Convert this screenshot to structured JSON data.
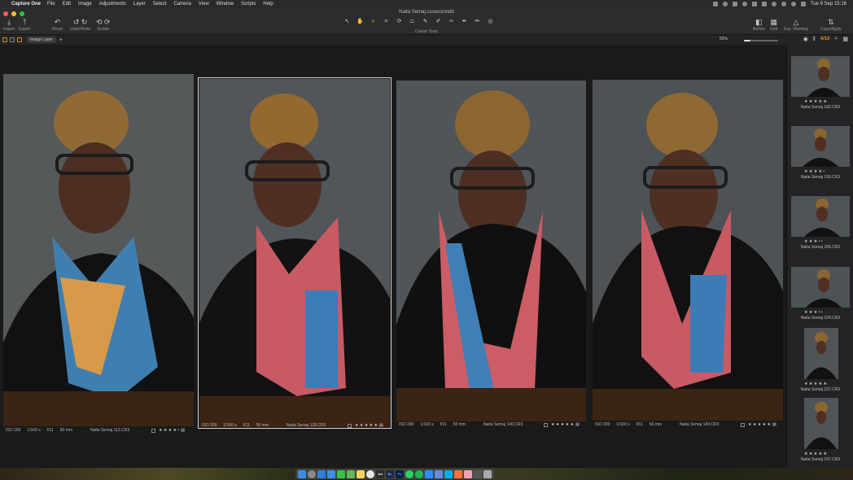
{
  "menubar": {
    "app_name": "Capture One",
    "items": [
      "File",
      "Edit",
      "Image",
      "Adjustments",
      "Layer",
      "Select",
      "Camera",
      "View",
      "Window",
      "Scripts",
      "Help"
    ],
    "clock": "Tue 9 Sep  15:16"
  },
  "window": {
    "title": "Naita Semaj.cosessiondb"
  },
  "toolbar": {
    "import": "Import",
    "export": "Export",
    "reset": "Reset",
    "undo_redo": "Undo/Redo",
    "rotate": "Rotate",
    "cursor_tools": "Cursor Tools",
    "before": "Before",
    "grid": "Grid",
    "exp_warning": "Exp. Warning",
    "copy_apply": "Copy/Apply"
  },
  "viewbar": {
    "layer": "Image Layer",
    "zoom": "50%",
    "zoom_fraction": 0.2,
    "counter": "4/10"
  },
  "viewer": {
    "photos": [
      {
        "iso": "ISO 200",
        "shutter": "1/160 s",
        "aperture": "f/11",
        "focal": "50 mm",
        "file": "Naita Semaj 112.CR3",
        "stars": "★ ★ ★ ★ •",
        "selected": false
      },
      {
        "iso": "ISO 200",
        "shutter": "1/160 s",
        "aperture": "f/11",
        "focal": "50 mm",
        "file": "Naita Semaj 128.CR3",
        "stars": "★ ★ ★ ★ ★",
        "selected": true
      },
      {
        "iso": "ISO 200",
        "shutter": "1/160 s",
        "aperture": "f/11",
        "focal": "50 mm",
        "file": "Naita Semaj 140.CR3",
        "stars": "★ ★ ★ ★ ★",
        "selected": false
      },
      {
        "iso": "ISO 200",
        "shutter": "1/160 s",
        "aperture": "f/11",
        "focal": "50 mm",
        "file": "Naita Semaj 149.CR3",
        "stars": "★ ★ ★ ★ ★",
        "selected": false
      }
    ]
  },
  "filmstrip": {
    "items": [
      {
        "name": "Naita Semaj 182.CR3",
        "stars": "★ ★ ★ ★ ★"
      },
      {
        "name": "Naita Semaj 190.CR3",
        "stars": "★ ★ ★ ★ •"
      },
      {
        "name": "Naita Semaj 206.CR3",
        "stars": "★ ★ ★ • •"
      },
      {
        "name": "Naita Semaj 224.CR3",
        "stars": "★ ★ ★ • •"
      },
      {
        "name": "Naita Semaj 237.CR3",
        "stars": "★ ★ ★ ★ ★"
      },
      {
        "name": "Naita Semaj 247.CR3",
        "stars": "★ ★ ★ ★ ★"
      }
    ]
  },
  "dock": {
    "icons": [
      "finder-icon",
      "launchpad-icon",
      "safari-icon",
      "mail-icon",
      "messages-icon",
      "maps-icon",
      "notes-icon",
      "chrome-icon",
      "capture-one-icon",
      "bridge-icon",
      "photoshop-icon",
      "whatsapp-icon",
      "spotify-icon",
      "zoom-icon",
      "app-store-icon",
      "skype-icon",
      "firefox-icon",
      "preview-icon",
      "activity-icon",
      "trash-icon"
    ],
    "labels": {
      "capture_one": "Jm",
      "bridge": "Br",
      "photoshop": "Ps"
    }
  }
}
